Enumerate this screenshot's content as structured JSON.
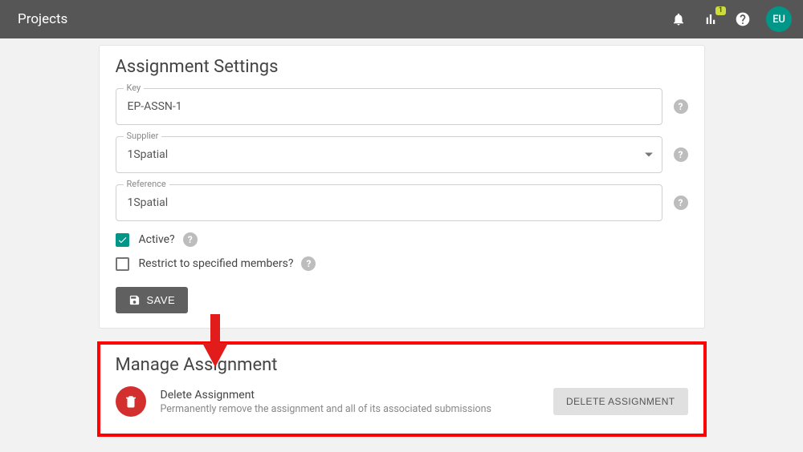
{
  "header": {
    "title": "Projects",
    "badge_count": "1",
    "avatar_initials": "EU"
  },
  "settings": {
    "card_title": "Assignment Settings",
    "key_label": "Key",
    "key_value": "EP-ASSN-1",
    "supplier_label": "Supplier",
    "supplier_value": "1Spatial",
    "reference_label": "Reference",
    "reference_value": "1Spatial",
    "active_label": "Active?",
    "restrict_label": "Restrict to specified members?",
    "save_label": "SAVE",
    "help_glyph": "?"
  },
  "manage": {
    "card_title": "Manage Assignment",
    "delete_title": "Delete Assignment",
    "delete_desc": "Permanently remove the assignment and all of its associated submissions",
    "delete_button_label": "DELETE ASSIGNMENT"
  }
}
